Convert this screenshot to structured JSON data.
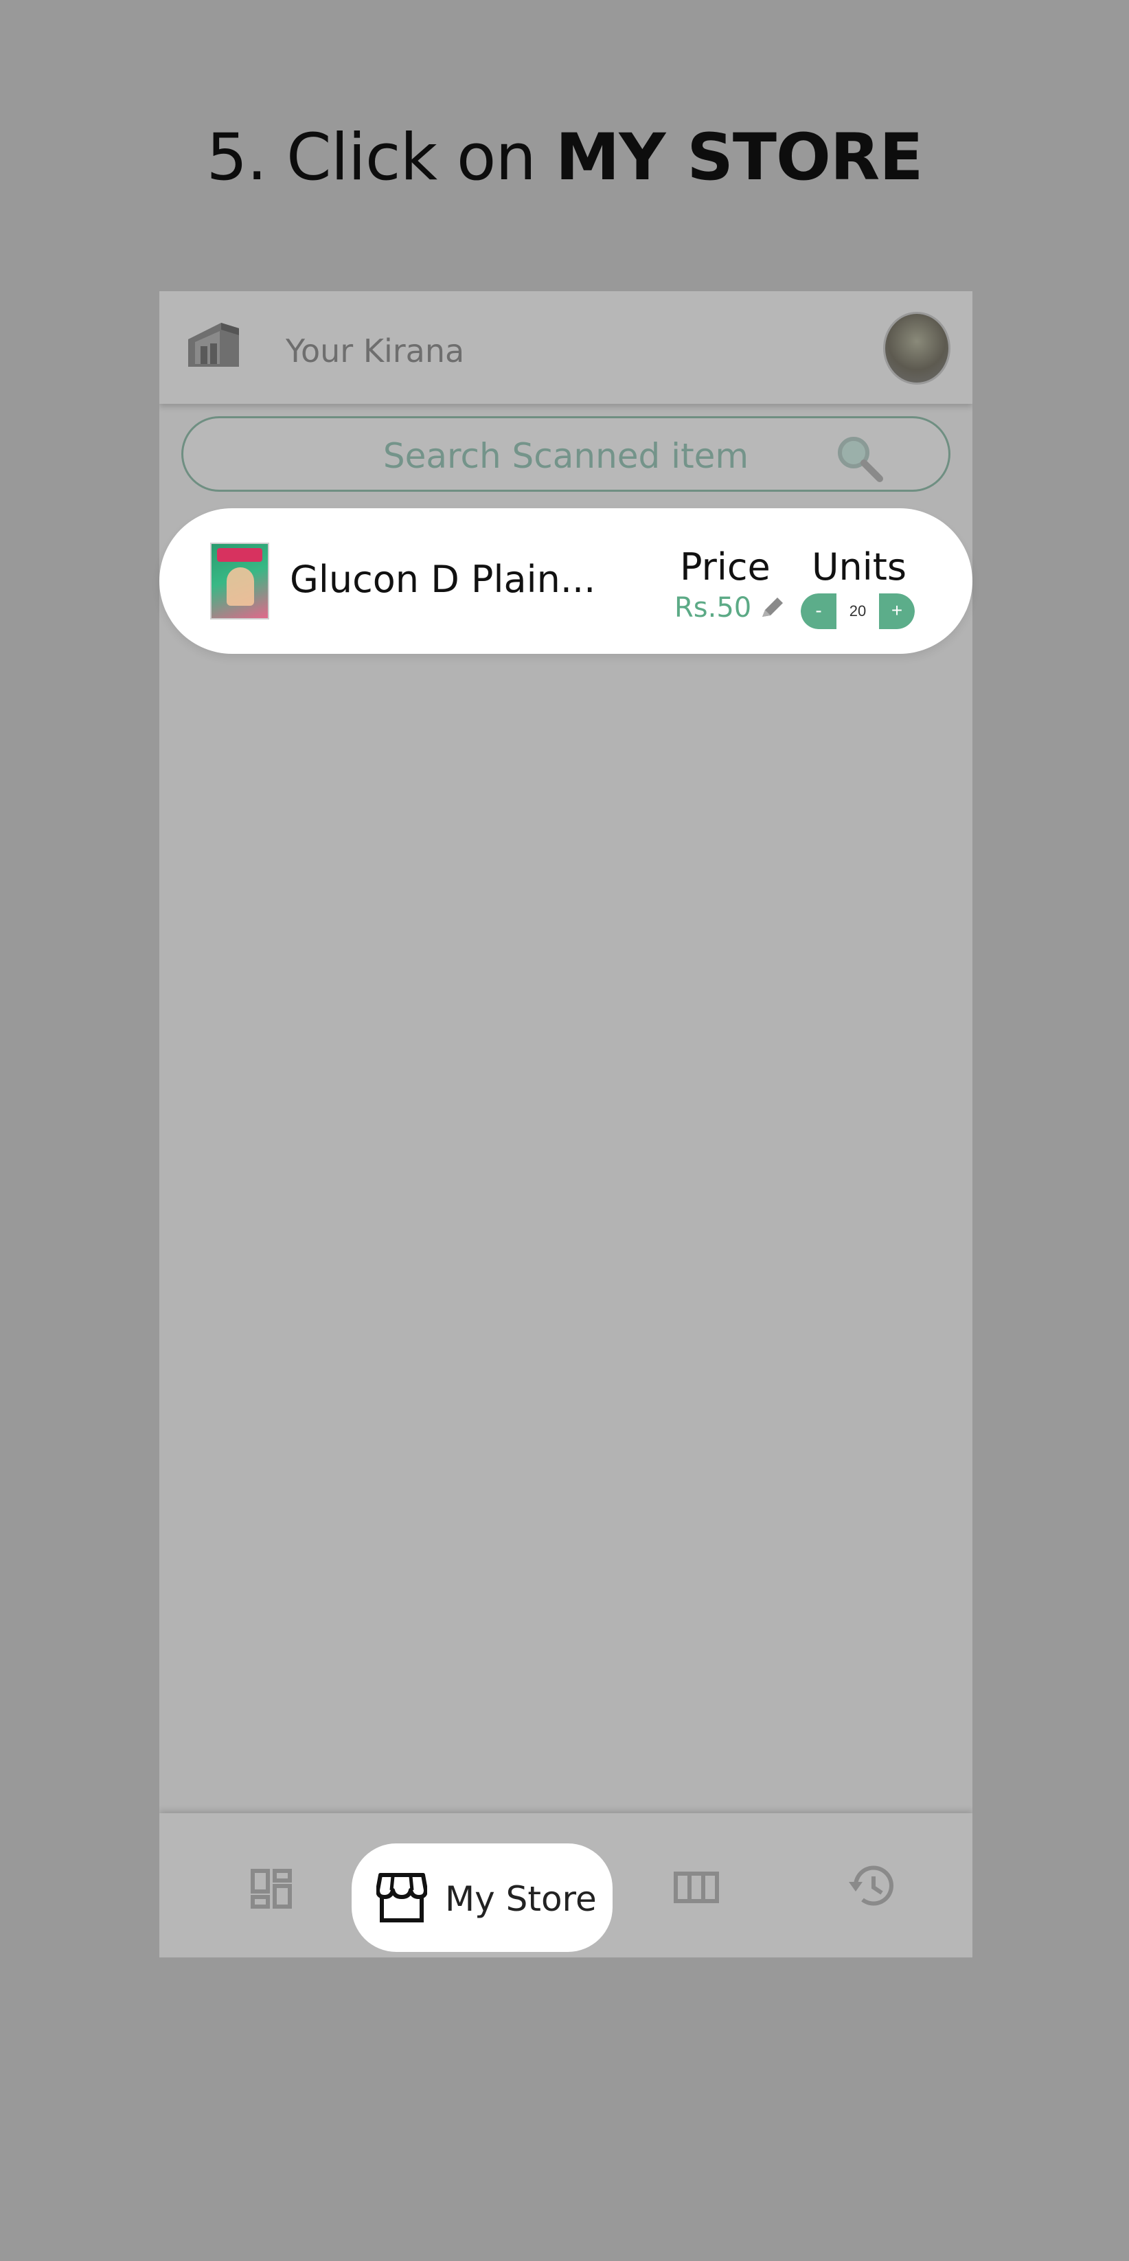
{
  "instruction": {
    "prefix": "5. Click on ",
    "emphasis": "MY STORE"
  },
  "app": {
    "title": "Your Kirana",
    "logo_icon": "store-logo-icon",
    "avatar_icon": "user-avatar"
  },
  "search": {
    "placeholder": "Search Scanned item",
    "icon": "search-icon"
  },
  "item": {
    "name": "Glucon D Plain...",
    "price_label": "Price",
    "price_value": "Rs.50",
    "units_label": "Units",
    "minus": "-",
    "quantity": "20",
    "plus": "+"
  },
  "nav": {
    "items": [
      {
        "icon": "dashboard-icon",
        "label": ""
      },
      {
        "icon": "storefront-icon",
        "label": "My Store",
        "active": true
      },
      {
        "icon": "columns-icon",
        "label": ""
      },
      {
        "icon": "history-icon",
        "label": ""
      }
    ]
  },
  "colors": {
    "overlay": "#999999",
    "accent": "#5cad8a",
    "price": "#5caa86",
    "search_border": "#6f8f82"
  }
}
